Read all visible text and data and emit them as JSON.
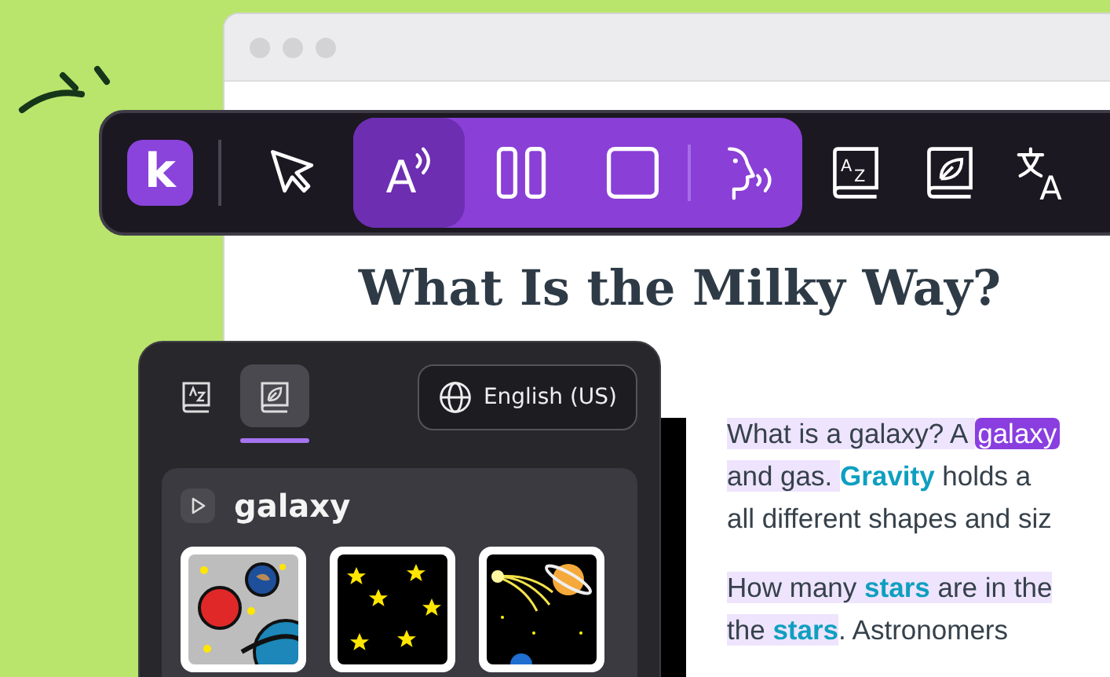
{
  "toolbar": {
    "logo": "k",
    "tools": [
      {
        "kind": "select",
        "selected": false
      },
      {
        "kind": "read-aloud",
        "glyph": "A",
        "selected": true
      },
      {
        "kind": "pause",
        "selected": false
      },
      {
        "kind": "stop",
        "selected": false
      },
      {
        "kind": "voice",
        "selected": false
      },
      {
        "kind": "dictionary",
        "glyph": "AZ",
        "selected": false
      },
      {
        "kind": "picture-dictionary",
        "selected": false
      },
      {
        "kind": "translate",
        "glyph": "A",
        "selected": false
      }
    ]
  },
  "article": {
    "title": "What Is the Milky Way?",
    "paragraphs": [
      [
        [
          {
            "text": "What is a galaxy? A ",
            "reading": true,
            "kind": "plain"
          },
          {
            "text": "galaxy",
            "reading": false,
            "kind": "current"
          }
        ],
        [
          {
            "text": "and gas. ",
            "reading": true,
            "kind": "plain"
          },
          {
            "text": "Gravity",
            "reading": false,
            "kind": "vocab"
          },
          {
            "text": " holds a",
            "reading": false,
            "kind": "plain"
          }
        ],
        [
          {
            "text": "all different shapes and siz",
            "reading": false,
            "kind": "plain"
          }
        ]
      ],
      [
        [
          {
            "text": "How many ",
            "reading": true,
            "kind": "plain"
          },
          {
            "text": "stars",
            "reading": true,
            "kind": "vocab"
          },
          {
            "text": " are in the",
            "reading": true,
            "kind": "plain"
          }
        ],
        [
          {
            "text": "the ",
            "reading": true,
            "kind": "plain"
          },
          {
            "text": "stars",
            "reading": true,
            "kind": "vocab"
          },
          {
            "text": ". Astronomers",
            "reading": false,
            "kind": "plain"
          }
        ]
      ]
    ]
  },
  "panel": {
    "tabs": [
      {
        "kind": "dictionary",
        "selected": false
      },
      {
        "kind": "picture-dictionary",
        "selected": true
      }
    ],
    "language": "English (US)",
    "entry": {
      "word": "galaxy",
      "pictures": [
        {
          "kind": "planets"
        },
        {
          "kind": "stars"
        },
        {
          "kind": "comet"
        }
      ]
    }
  }
}
